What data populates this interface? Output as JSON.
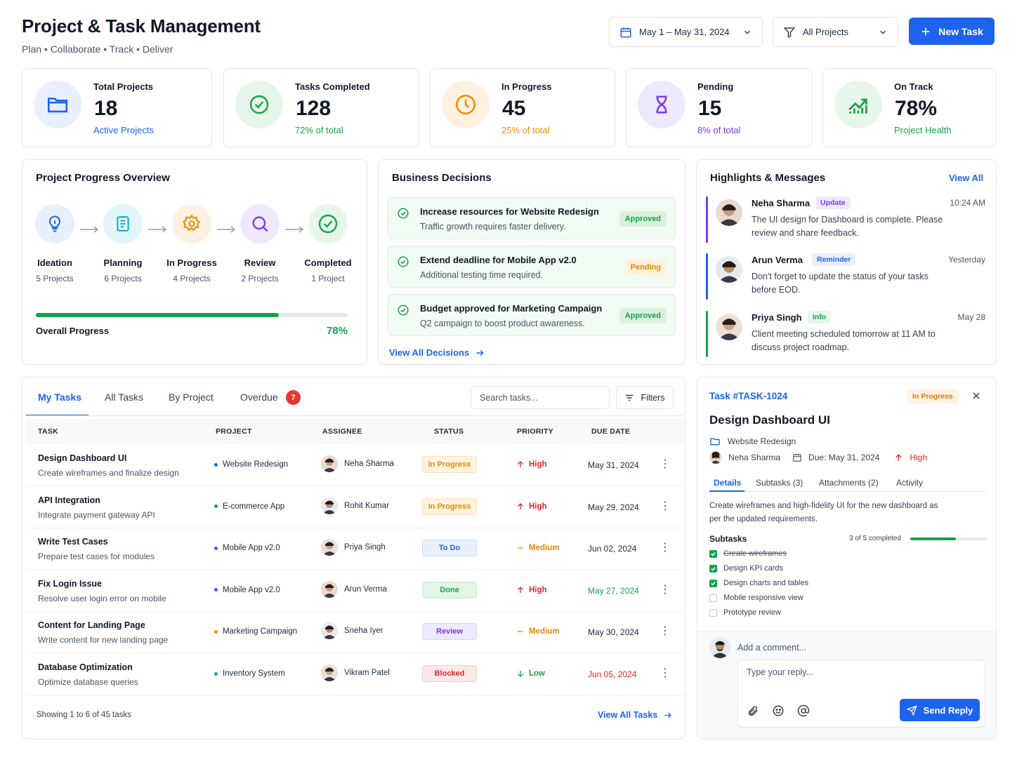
{
  "header": {
    "title": "Project & Task Management",
    "subtitle": "Plan • Collaborate • Track • Deliver",
    "date_range": "May 1 – May 31, 2024",
    "project_filter": "All Projects",
    "new_task": "New Task"
  },
  "stats": [
    {
      "label": "Total Projects",
      "value": "18",
      "foot": "Active Projects",
      "color": "#1d63ed",
      "bg": "#e8f0fe",
      "icon": "folder-icon"
    },
    {
      "label": "Tasks Completed",
      "value": "128",
      "foot": "72% of total",
      "color": "#16a34a",
      "bg": "#e7f6ea",
      "icon": "check-circle-icon"
    },
    {
      "label": "In Progress",
      "value": "45",
      "foot": "25% of total",
      "color": "#f08c00",
      "bg": "#fff1df",
      "icon": "clock-icon"
    },
    {
      "label": "Pending",
      "value": "15",
      "foot": "8% of total",
      "color": "#7c3aed",
      "bg": "#efe9fd",
      "icon": "hourglass-icon"
    },
    {
      "label": "On Track",
      "value": "78%",
      "foot": "Project Health",
      "color": "#16a34a",
      "bg": "#e7f6ea",
      "icon": "trend-up-icon"
    }
  ],
  "progress": {
    "title": "Project Progress Overview",
    "stages": [
      {
        "name": "Ideation",
        "count": "5 Projects",
        "color": "#1d63ed",
        "bg": "#e8f0fe",
        "icon": "lightbulb-icon"
      },
      {
        "name": "Planning",
        "count": "6 Projects",
        "color": "#0ea5c6",
        "bg": "#e2f5fa",
        "icon": "document-icon"
      },
      {
        "name": "In Progress",
        "count": "4 Projects",
        "color": "#f08c00",
        "bg": "#fff1df",
        "icon": "gear-icon"
      },
      {
        "name": "Review",
        "count": "2 Projects",
        "color": "#7c3aed",
        "bg": "#efe9fd",
        "icon": "search-icon"
      },
      {
        "name": "Completed",
        "count": "1 Project",
        "color": "#16a34a",
        "bg": "#e7f6ea",
        "icon": "check-circle-icon"
      }
    ],
    "overall_label": "Overall Progress",
    "overall_value": "78%",
    "overall_pct": 78
  },
  "decisions": {
    "title": "Business Decisions",
    "items": [
      {
        "title": "Increase resources for Website Redesign",
        "desc": "Traffic growth requires faster delivery.",
        "status": "Approved"
      },
      {
        "title": "Extend deadline for Mobile App v2.0",
        "desc": "Additional testing time required.",
        "status": "Pending"
      },
      {
        "title": "Budget approved for Marketing Campaign",
        "desc": "Q2 campaign to boost product awareness.",
        "status": "Approved"
      }
    ],
    "view_all": "View All Decisions"
  },
  "messages": {
    "title": "Highlights & Messages",
    "view_all": "View All",
    "items": [
      {
        "name": "Neha Sharma",
        "tag": "Update",
        "time": "10:24 AM",
        "text": "The UI design for Dashboard is complete. Please review and share feedback.",
        "bar": "#7c3aed",
        "tagbg": "#efe9fd",
        "tagfg": "#7c3aed"
      },
      {
        "name": "Arun Verma",
        "tag": "Reminder",
        "time": "Yesterday",
        "text": "Don't forget to update the status of your tasks before EOD.",
        "bar": "#1d63ed",
        "tagbg": "#e8f0fe",
        "tagfg": "#1d63ed"
      },
      {
        "name": "Priya Singh",
        "tag": "Info",
        "time": "May 28",
        "text": "Client meeting scheduled tomorrow at 11 AM to discuss project roadmap.",
        "bar": "#16a34a",
        "tagbg": "#e7f6ea",
        "tagfg": "#16a34a"
      }
    ]
  },
  "tasks": {
    "tabs": [
      "My Tasks",
      "All Tasks",
      "By Project",
      "Overdue"
    ],
    "overdue_count": "7",
    "search_placeholder": "Search tasks...",
    "filters": "Filters",
    "columns": [
      "TASK",
      "PROJECT",
      "ASSIGNEE",
      "STATUS",
      "PRIORITY",
      "DUE DATE"
    ],
    "rows": [
      {
        "name": "Design Dashboard UI",
        "desc": "Create wireframes and finalize design",
        "project": "Website Redesign",
        "pcolor": "#1d63ed",
        "assignee": "Neha Sharma",
        "status": "In Progress",
        "priority": "High",
        "due": "May 31, 2024",
        "overdue": false
      },
      {
        "name": "API Integration",
        "desc": "Integrate payment gateway API",
        "project": "E-commerce App",
        "pcolor": "#16a34a",
        "assignee": "Rohit Kumar",
        "status": "In Progress",
        "priority": "High",
        "due": "May 29, 2024",
        "overdue": false
      },
      {
        "name": "Write Test Cases",
        "desc": "Prepare test cases for modules",
        "project": "Mobile App v2.0",
        "pcolor": "#7c3aed",
        "assignee": "Priya Singh",
        "status": "To Do",
        "priority": "Medium",
        "due": "Jun 02, 2024",
        "overdue": false
      },
      {
        "name": "Fix Login Issue",
        "desc": "Resolve user login error on mobile",
        "project": "Mobile App v2.0",
        "pcolor": "#7c3aed",
        "assignee": "Arun Verma",
        "status": "Done",
        "priority": "High",
        "due": "May 27, 2024",
        "overdue": "done"
      },
      {
        "name": "Content for Landing Page",
        "desc": "Write content for new landing page",
        "project": "Marketing Campaign",
        "pcolor": "#f08c00",
        "assignee": "Sneha Iyer",
        "status": "Review",
        "priority": "Medium",
        "due": "May 30, 2024",
        "overdue": false
      },
      {
        "name": "Database Optimization",
        "desc": "Optimize database queries",
        "project": "Inventory System",
        "pcolor": "#0ea5c6",
        "assignee": "Vikram Patel",
        "status": "Blocked",
        "priority": "Low",
        "due": "Jun 05, 2024",
        "overdue": "late"
      }
    ],
    "showing": "Showing 1 to 6 of 45 tasks",
    "view_all": "View All Tasks"
  },
  "detail": {
    "id": "Task #TASK-1024",
    "status": "In Progress",
    "title": "Design Dashboard UI",
    "project": "Website Redesign",
    "assignee": "Neha Sharma",
    "due": "Due: May 31, 2024",
    "priority": "High",
    "tabs": [
      "Details",
      "Subtasks (3)",
      "Attachments (2)",
      "Activity"
    ],
    "description": "Create wireframes and high-fidelity UI for the new dashboard as per the updated requirements.",
    "subtasks_label": "Subtasks",
    "subtasks_progress": "3 of 5 completed",
    "subtasks_fraction": 0.6,
    "subtasks": [
      {
        "text": "Create wireframes",
        "done": true,
        "strike": true
      },
      {
        "text": "Design KPI cards",
        "done": true,
        "strike": false
      },
      {
        "text": "Design charts and tables",
        "done": true,
        "strike": false
      },
      {
        "text": "Mobile responsive view",
        "done": false,
        "strike": false
      },
      {
        "text": "Prototype review",
        "done": false,
        "strike": false
      }
    ],
    "comment_label": "Add a comment...",
    "reply_placeholder": "Type your reply...",
    "send": "Send Reply"
  }
}
